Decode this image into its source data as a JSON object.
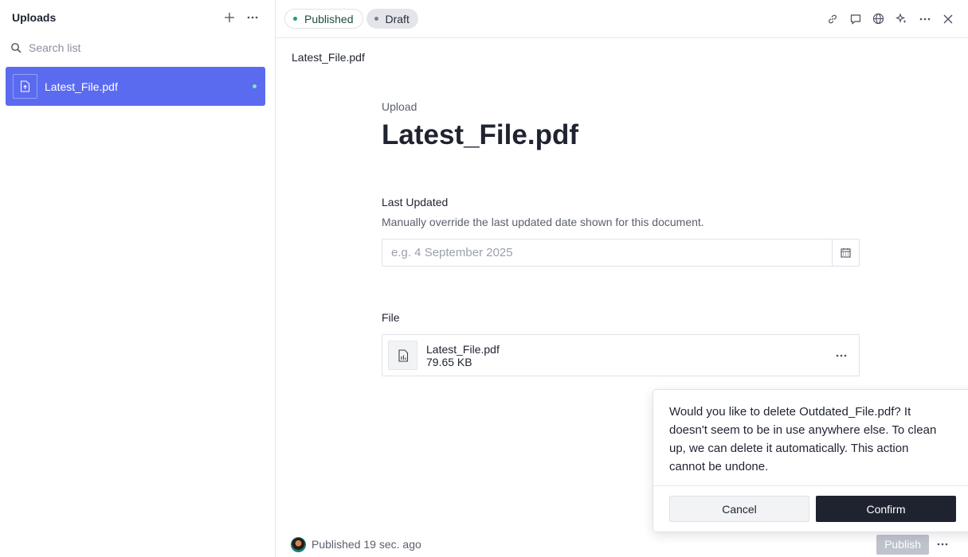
{
  "sidebar": {
    "title": "Uploads",
    "search_placeholder": "Search list",
    "items": [
      {
        "label": "Latest_File.pdf",
        "selected": true
      }
    ]
  },
  "topbar": {
    "published_label": "Published",
    "draft_label": "Draft",
    "published_dot_color": "#1fa36b",
    "draft_dot_color": "#7b808c"
  },
  "document": {
    "breadcrumb": "Latest_File.pdf",
    "type": "Upload",
    "title": "Latest_File.pdf",
    "last_updated": {
      "label": "Last Updated",
      "description": "Manually override the last updated date shown for this document.",
      "placeholder": "e.g. 4 September 2025",
      "value": ""
    },
    "file": {
      "label": "File",
      "name": "Latest_File.pdf",
      "size": "79.65 KB"
    }
  },
  "footer": {
    "status": "Published 19 sec. ago",
    "publish_label": "Publish"
  },
  "popover": {
    "message": "Would you like to delete Outdated_File.pdf? It doesn't seem to be in use anywhere else. To clean up, we can delete it automatically. This action cannot be undone.",
    "cancel_label": "Cancel",
    "confirm_label": "Confirm"
  },
  "colors": {
    "accent": "#5b6bf0",
    "dark_button": "#1f2330"
  }
}
